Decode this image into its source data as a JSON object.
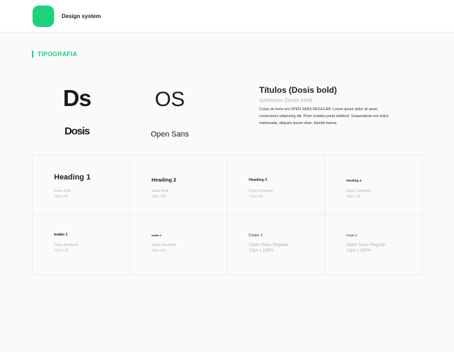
{
  "colors": {
    "accent": "#1fd07f"
  },
  "header": {
    "title": "Design system"
  },
  "section": {
    "title": "TIPOGRAFIA"
  },
  "fonts": [
    {
      "glyph": "Ds",
      "name": "Dosis"
    },
    {
      "glyph": "OS",
      "name": "Open Sans"
    }
  ],
  "sample": {
    "title": "Títulos (Dosis bold)",
    "subtitle": "Subtítulos (Dosis bold)",
    "body": "Corpo do texto em OPEN SANS REGULAR.  Lorem ipsum dolor sit amet, consectetur adipiscing elit. Proin sodales porta eleifend. Suspendisse non tellus malesuada, aliquam ipsum vitae, blandit massa."
  },
  "styles": [
    {
      "name": "Heading 1",
      "meta1": "Dosis Bold",
      "meta2": "34px L41"
    },
    {
      "name": "Heading 2",
      "meta1": "Dosis Bold",
      "meta2": "22px L28"
    },
    {
      "name": "Heading 3",
      "meta1": "Dosis Semibold",
      "meta2": "17px L22"
    },
    {
      "name": "Heading 4",
      "meta1": "Dosis Semibold",
      "meta2": "15px L20"
    },
    {
      "name": "botão 1",
      "meta1": "Dosis Semibold",
      "meta2": "17px L22"
    },
    {
      "name": "botão 2",
      "meta1": "Dosis Semibold",
      "meta2": "12px L16"
    },
    {
      "name": "Corpo 1",
      "meta1": "Open Sans Regular",
      "meta2": "15px L180%"
    },
    {
      "name": "Corpo 2",
      "meta1": "Open Sans Regular",
      "meta2": "13px L180%"
    }
  ]
}
